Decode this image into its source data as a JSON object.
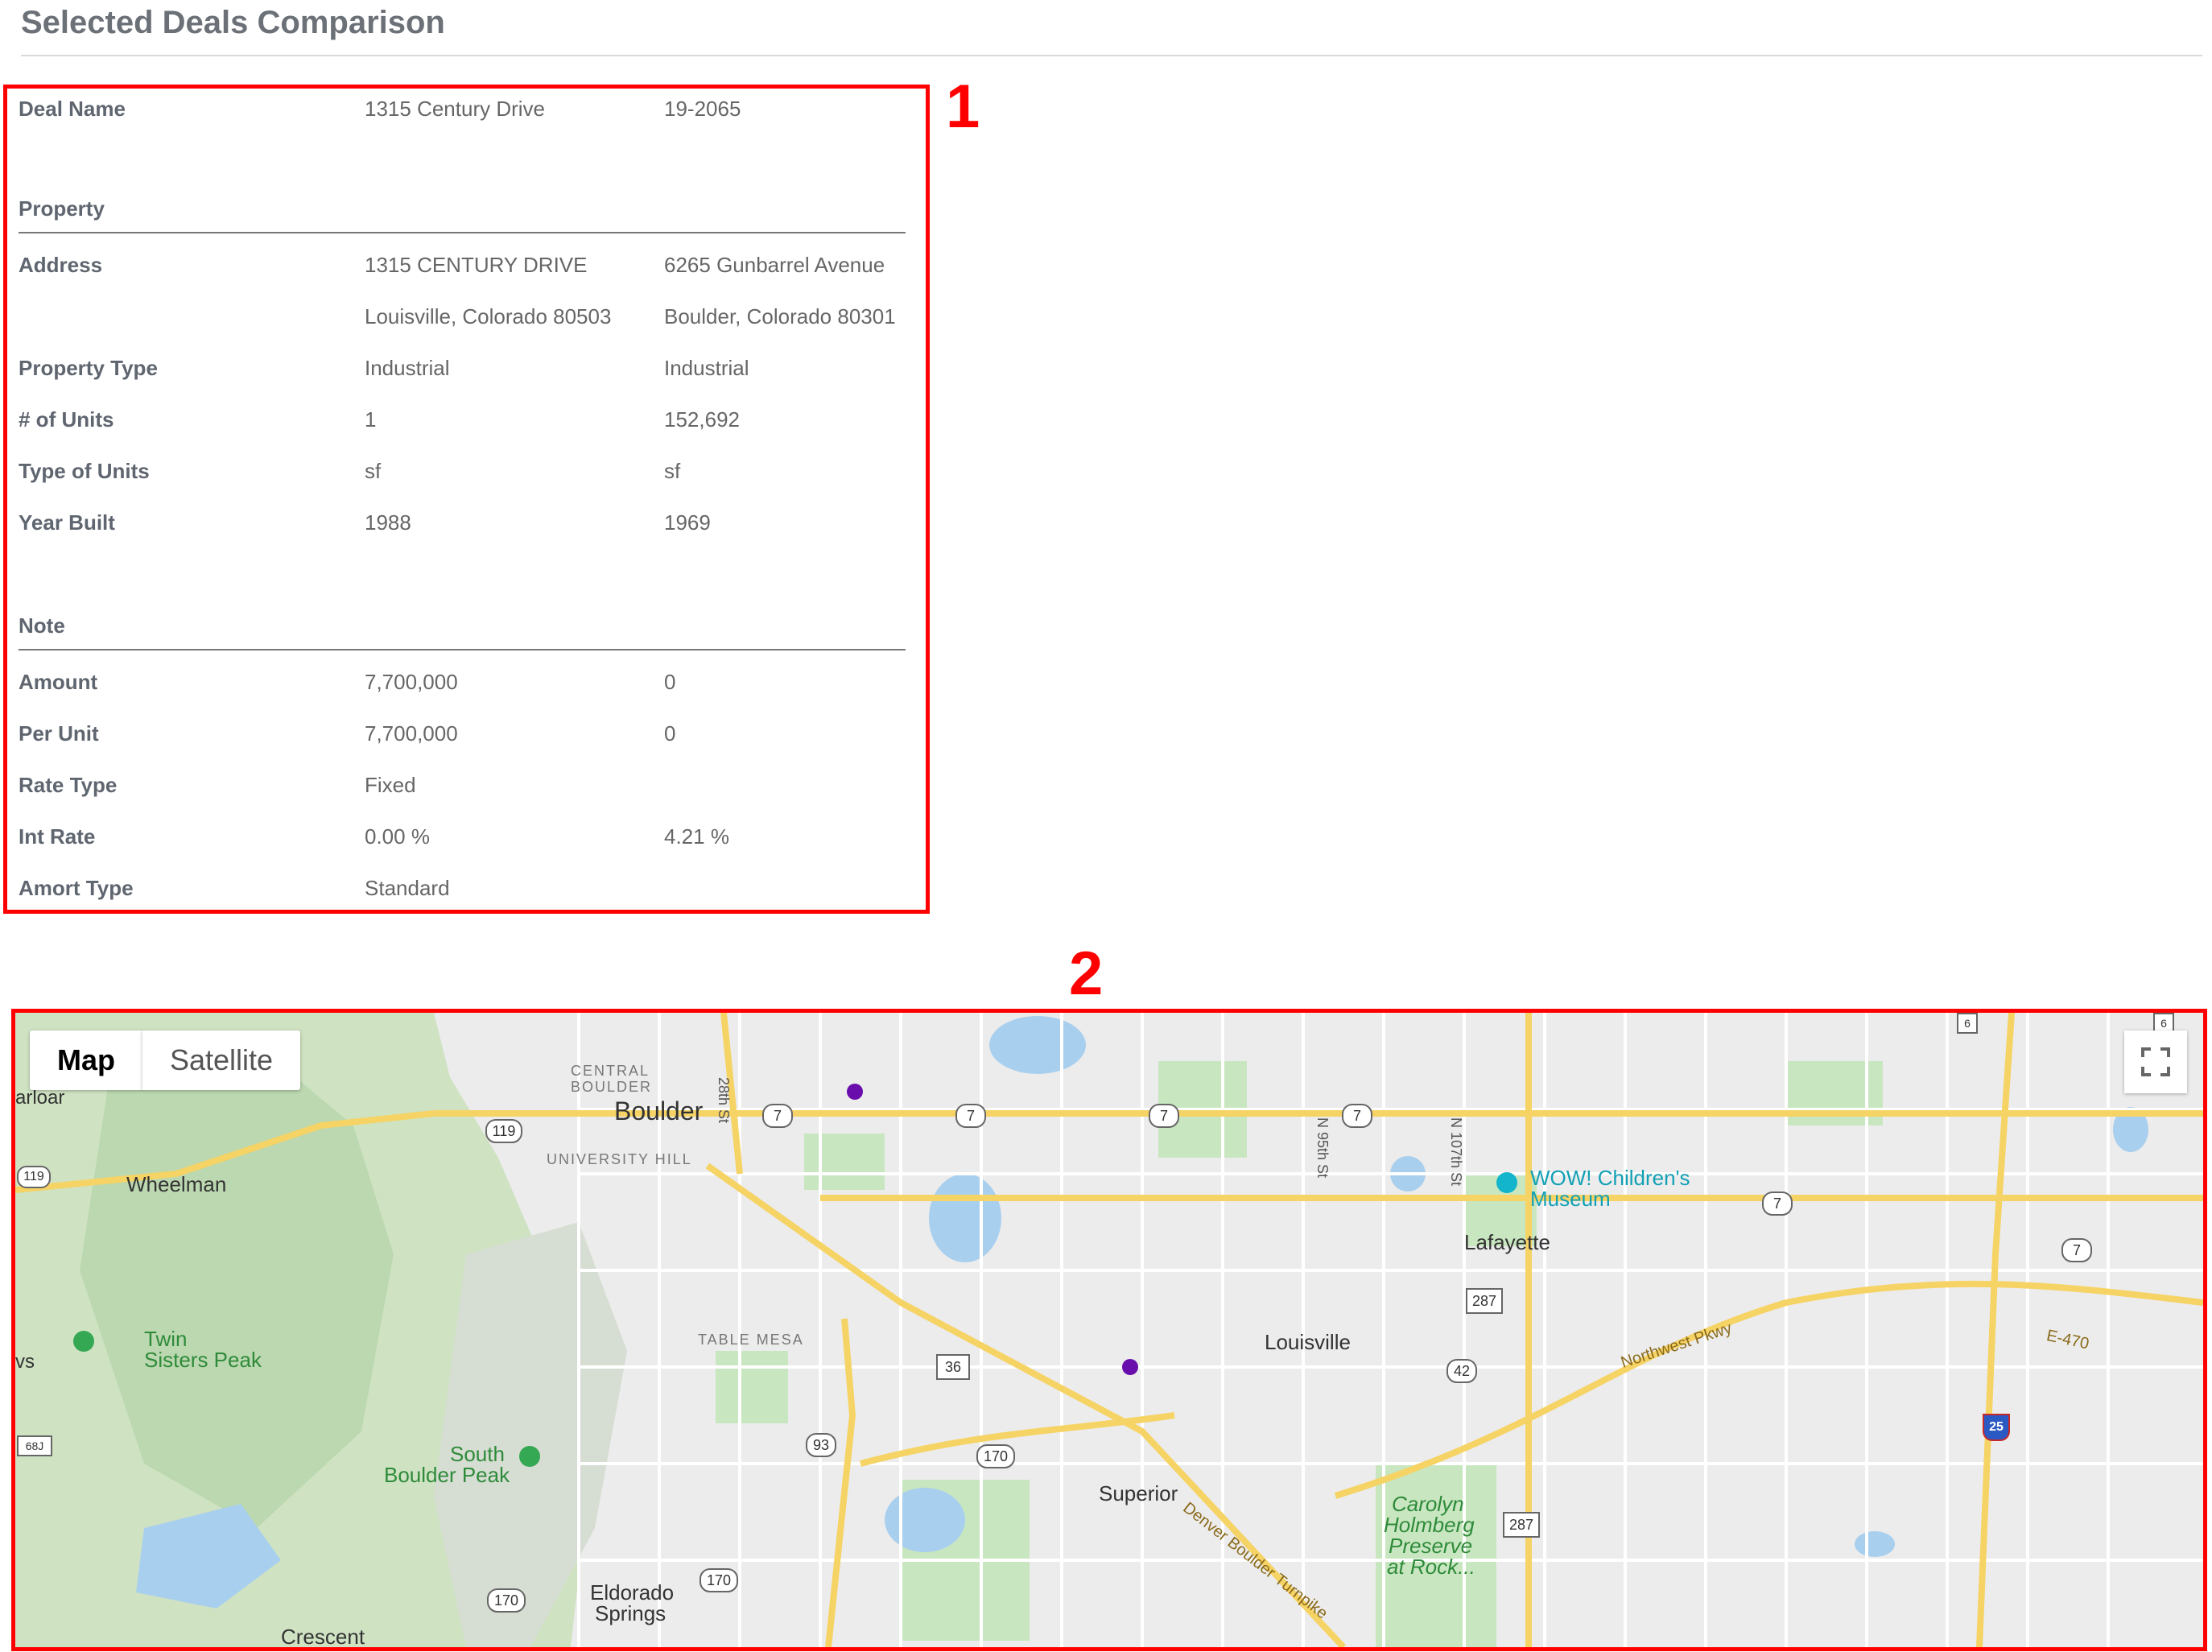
{
  "page": {
    "title": "Selected Deals Comparison"
  },
  "annotations": {
    "box1_label": "1",
    "box2_label": "2"
  },
  "deal": {
    "label": "Deal Name",
    "v1": "1315 Century Drive",
    "v2": "19-2065"
  },
  "property": {
    "section_title": "Property",
    "rows": [
      {
        "label": "Address",
        "v1": "1315 CENTURY DRIVE",
        "v2": "6265 Gunbarrel Avenue"
      },
      {
        "label": "",
        "v1": "Louisville, Colorado 80503",
        "v2": "Boulder, Colorado 80301"
      },
      {
        "label": "Property Type",
        "v1": "Industrial",
        "v2": "Industrial"
      },
      {
        "label": "# of Units",
        "v1": "1",
        "v2": "152,692"
      },
      {
        "label": "Type of Units",
        "v1": "sf",
        "v2": "sf"
      },
      {
        "label": "Year Built",
        "v1": "1988",
        "v2": "1969"
      }
    ]
  },
  "note": {
    "section_title": "Note",
    "rows": [
      {
        "label": "Amount",
        "v1": "7,700,000",
        "v2": "0"
      },
      {
        "label": "Per Unit",
        "v1": "7,700,000",
        "v2": "0"
      },
      {
        "label": "Rate Type",
        "v1": "Fixed",
        "v2": ""
      },
      {
        "label": "Int Rate",
        "v1": "0.00 %",
        "v2": "4.21 %"
      },
      {
        "label": "Amort Type",
        "v1": "Standard",
        "v2": ""
      }
    ]
  },
  "map": {
    "map_button": "Map",
    "satellite_button": "Satellite",
    "colors": {
      "marker": "#6a0dad",
      "highway": "#f6d365",
      "park": "#c8e6c0",
      "water": "#a9cfee",
      "land": "#ececec"
    },
    "labels": {
      "boulder": "Boulder",
      "central_boulder_1": "CENTRAL",
      "central_boulder_2": "BOULDER",
      "university_hill": "UNIVERSITY HILL",
      "wheelman": "Wheelman",
      "twin_1": "Twin",
      "twin_2": "Sisters Peak",
      "table_mesa": "TABLE MESA",
      "south_1": "South",
      "south_2": "Boulder Peak",
      "louisville": "Louisville",
      "lafayette": "Lafayette",
      "superior": "Superior",
      "eldorado_1": "Eldorado",
      "eldorado_2": "Springs",
      "crescent": "Crescent",
      "wow_1": "WOW! Children's",
      "wow_2": "Museum",
      "carolyn_1": "Carolyn",
      "carolyn_2": "Holmberg",
      "carolyn_3": "Preserve",
      "carolyn_4": "at Rock...",
      "northwest_pkwy": "Northwest Pkwy",
      "e470": "E-470",
      "denver_turnpike": "Denver Boulder Turnpike",
      "st_28th": "28th St",
      "st_n95": "N 95th St",
      "st_n107": "N 107th St",
      "arloar": "arloar",
      "vs": "vs"
    },
    "shields": {
      "r7": "7",
      "r119": "119",
      "r36": "36",
      "r93": "93",
      "r170": "170",
      "r287": "287",
      "r42": "42",
      "r25": "25",
      "r6": "6",
      "r68j": "68J"
    }
  }
}
